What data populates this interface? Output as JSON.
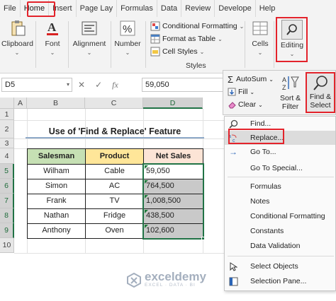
{
  "tabs": [
    "File",
    "Home",
    "Insert",
    "Page Lay",
    "Formulas",
    "Data",
    "Review",
    "Develope",
    "Help"
  ],
  "ribbon": {
    "clipboard": "Clipboard",
    "font": "Font",
    "alignment": "Alignment",
    "number": "Number",
    "cond_format": "Conditional Formatting",
    "format_table": "Format as Table",
    "cell_styles": "Cell Styles",
    "styles_group": "Styles",
    "cells": "Cells",
    "editing": "Editing"
  },
  "formula_bar": {
    "name_box": "D5",
    "cancel": "✕",
    "enter": "✓",
    "fx": "fx",
    "value": "59,050"
  },
  "columns": [
    "A",
    "B",
    "C",
    "D"
  ],
  "rows": [
    "1",
    "2",
    "3",
    "4",
    "5",
    "6",
    "7",
    "8",
    "9",
    "10"
  ],
  "sheet": {
    "title": "Use of 'Find & Replace' Feature",
    "headers": [
      "Salesman",
      "Product",
      "Net Sales"
    ],
    "records": [
      {
        "salesman": "Wilham",
        "product": "Cable",
        "sales": "59,050"
      },
      {
        "salesman": "Simon",
        "product": "AC",
        "sales": "764,500"
      },
      {
        "salesman": "Frank",
        "product": "TV",
        "sales": "1,008,500"
      },
      {
        "salesman": "Nathan",
        "product": "Fridge",
        "sales": "438,500"
      },
      {
        "salesman": "Anthony",
        "product": "Oven",
        "sales": "102,600"
      }
    ]
  },
  "editing_panel": {
    "autosum": "AutoSum",
    "fill": "Fill",
    "clear": "Clear",
    "sort_1": "Sort &",
    "sort_2": "Filter",
    "find_1": "Find &",
    "find_2": "Select"
  },
  "menu": {
    "find": "Find...",
    "replace": "Replace...",
    "goto": "Go To...",
    "goto_special": "Go To Special...",
    "formulas": "Formulas",
    "notes": "Notes",
    "conditional_formatting": "Conditional Formatting",
    "constants": "Constants",
    "data_validation": "Data Validation",
    "select_objects": "Select Objects",
    "selection_pane": "Selection Pane..."
  },
  "watermark": {
    "name": "exceldemy",
    "sub": "EXCEL · DATA · BI"
  },
  "colors": {
    "header_salesman": "#c6e0b4",
    "header_product": "#ffe699",
    "header_sales": "#fce4d6",
    "highlight": "#e3232b",
    "excel_green": "#217346"
  }
}
